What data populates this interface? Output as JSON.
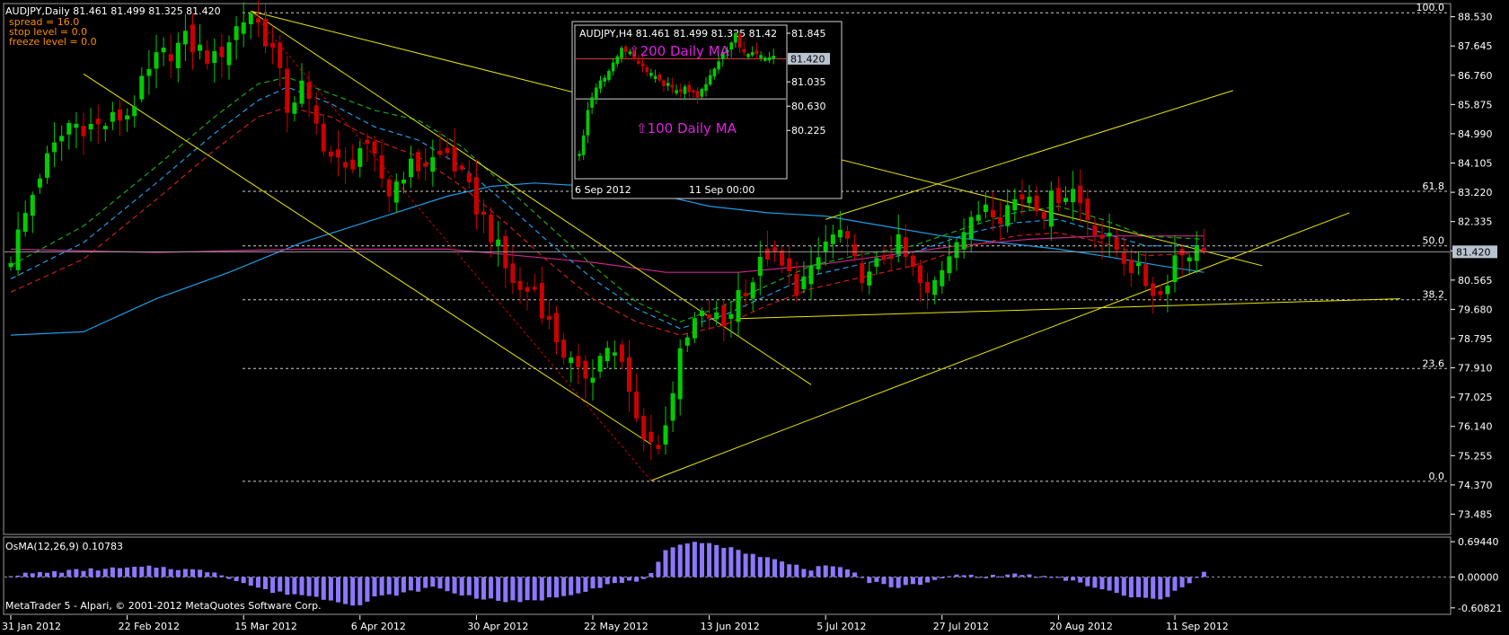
{
  "header": {
    "symbol_title": "AUDJPY,Daily  81.461 81.499 81.325 81.420",
    "spread": "spread = 16.0",
    "stop_level": "stop level = 0.0",
    "freeze_level": "freeze level = 0.0"
  },
  "footer": {
    "copyright": "MetaTrader 5 - Alpari, © 2001-2012 MetaQuotes Software Corp."
  },
  "colors": {
    "bull": "#00cc00",
    "bear": "#cc0000",
    "trendline": "#e6e600",
    "ma_blue": "#1e9be6",
    "ma_magenta": "#c8288c",
    "ma_green": "#1aa81a",
    "ma_red": "#c81e1e",
    "osma": "#8c78ff",
    "axis": "#ffffff"
  },
  "chart_data": [
    {
      "type": "candlestick",
      "symbol": "AUDJPY",
      "timeframe": "Daily",
      "current_price": 81.42,
      "current_price_label": "81.420",
      "ylim": [
        72.9,
        88.9
      ],
      "y_ticks": [
        "88.530",
        "87.645",
        "86.760",
        "85.875",
        "84.990",
        "84.105",
        "83.220",
        "82.335",
        "81.450",
        "80.565",
        "79.680",
        "78.795",
        "77.910",
        "77.025",
        "76.140",
        "75.255",
        "74.370",
        "73.485"
      ],
      "x_ticks": [
        {
          "label": "31 Jan 2012",
          "i": 0
        },
        {
          "label": "22 Feb 2012",
          "i": 16
        },
        {
          "label": "15 Mar 2012",
          "i": 32
        },
        {
          "label": "6 Apr 2012",
          "i": 48
        },
        {
          "label": "30 Apr 2012",
          "i": 64
        },
        {
          "label": "22 May 2012",
          "i": 80
        },
        {
          "label": "13 Jun 2012",
          "i": 96
        },
        {
          "label": "5 Jul 2012",
          "i": 112
        },
        {
          "label": "27 Jul 2012",
          "i": 128
        },
        {
          "label": "20 Aug 2012",
          "i": 144
        },
        {
          "label": "11 Sep 2012",
          "i": 160
        }
      ],
      "fibonacci": [
        {
          "label": "100.0",
          "price": 88.65
        },
        {
          "label": "61.8",
          "price": 83.25
        },
        {
          "label": "50.0",
          "price": 81.6
        },
        {
          "label": "38.2",
          "price": 79.97
        },
        {
          "label": "23.6",
          "price": 77.89
        },
        {
          "label": "0.0",
          "price": 74.48
        }
      ],
      "close_path": [
        [
          0,
          81.3
        ],
        [
          4,
          83.8
        ],
        [
          8,
          85.3
        ],
        [
          12,
          85.2
        ],
        [
          16,
          85.6
        ],
        [
          20,
          87.2
        ],
        [
          24,
          87.8
        ],
        [
          28,
          87.2
        ],
        [
          31,
          88.2
        ],
        [
          33,
          88.7
        ],
        [
          36,
          87.5
        ],
        [
          38,
          85.8
        ],
        [
          40,
          86.4
        ],
        [
          42,
          85.2
        ],
        [
          44,
          84.3
        ],
        [
          46,
          83.8
        ],
        [
          48,
          84.6
        ],
        [
          50,
          84.1
        ],
        [
          52,
          83.2
        ],
        [
          54,
          83.9
        ],
        [
          56,
          84.0
        ],
        [
          58,
          84.2
        ],
        [
          60,
          84.4
        ],
        [
          62,
          83.6
        ],
        [
          64,
          82.8
        ],
        [
          66,
          82.0
        ],
        [
          68,
          80.9
        ],
        [
          70,
          80.2
        ],
        [
          72,
          80.3
        ],
        [
          74,
          79.2
        ],
        [
          76,
          78.4
        ],
        [
          78,
          77.6
        ],
        [
          80,
          77.9
        ],
        [
          82,
          78.6
        ],
        [
          84,
          77.9
        ],
        [
          86,
          76.3
        ],
        [
          87,
          76.0
        ],
        [
          88,
          75.7
        ],
        [
          89,
          75.4
        ],
        [
          90,
          76.4
        ],
        [
          92,
          78.2
        ],
        [
          94,
          79.3
        ],
        [
          96,
          79.5
        ],
        [
          98,
          79.2
        ],
        [
          100,
          80.2
        ],
        [
          102,
          80.6
        ],
        [
          104,
          81.4
        ],
        [
          106,
          80.9
        ],
        [
          108,
          80.4
        ],
        [
          110,
          80.7
        ],
        [
          112,
          81.7
        ],
        [
          114,
          82.0
        ],
        [
          116,
          81.0
        ],
        [
          118,
          80.6
        ],
        [
          120,
          81.3
        ],
        [
          122,
          81.6
        ],
        [
          124,
          80.8
        ],
        [
          126,
          80.0
        ],
        [
          128,
          81.0
        ],
        [
          130,
          82.0
        ],
        [
          132,
          82.2
        ],
        [
          134,
          83.0
        ],
        [
          136,
          82.6
        ],
        [
          138,
          83.0
        ],
        [
          140,
          83.2
        ],
        [
          142,
          82.7
        ],
        [
          144,
          83.2
        ],
        [
          146,
          83.3
        ],
        [
          148,
          82.5
        ],
        [
          150,
          81.9
        ],
        [
          152,
          81.5
        ],
        [
          154,
          81.0
        ],
        [
          156,
          80.5
        ],
        [
          157,
          80.3
        ],
        [
          158,
          80.1
        ],
        [
          160,
          81.3
        ],
        [
          162,
          81.5
        ],
        [
          163,
          81.4
        ],
        [
          164,
          81.42
        ]
      ],
      "moving_averages": [
        {
          "color": "#1e9be6",
          "dash": "",
          "path": [
            [
              0,
              78.9
            ],
            [
              10,
              79.0
            ],
            [
              20,
              80.0
            ],
            [
              30,
              80.8
            ],
            [
              40,
              81.7
            ],
            [
              50,
              82.4
            ],
            [
              60,
              83.1
            ],
            [
              66,
              83.4
            ],
            [
              72,
              83.5
            ],
            [
              80,
              83.4
            ],
            [
              88,
              83.2
            ],
            [
              96,
              82.8
            ],
            [
              104,
              82.6
            ],
            [
              112,
              82.5
            ],
            [
              120,
              82.2
            ],
            [
              128,
              81.9
            ],
            [
              136,
              81.7
            ],
            [
              144,
              81.5
            ],
            [
              150,
              81.3
            ],
            [
              158,
              81.0
            ],
            [
              164,
              80.8
            ]
          ]
        },
        {
          "color": "#c8288c",
          "dash": "",
          "path": [
            [
              0,
              81.5
            ],
            [
              20,
              81.4
            ],
            [
              40,
              81.5
            ],
            [
              60,
              81.5
            ],
            [
              80,
              81.1
            ],
            [
              90,
              80.8
            ],
            [
              100,
              80.8
            ],
            [
              110,
              81.0
            ],
            [
              120,
              81.3
            ],
            [
              130,
              81.6
            ],
            [
              140,
              81.8
            ],
            [
              150,
              81.9
            ],
            [
              164,
              81.9
            ]
          ]
        },
        {
          "color": "#1aa81a",
          "dash": "6,4",
          "path": [
            [
              0,
              81.0
            ],
            [
              10,
              82.2
            ],
            [
              20,
              84.0
            ],
            [
              28,
              85.5
            ],
            [
              34,
              86.5
            ],
            [
              38,
              86.7
            ],
            [
              44,
              86.2
            ],
            [
              50,
              85.7
            ],
            [
              56,
              85.4
            ],
            [
              62,
              84.6
            ],
            [
              68,
              83.4
            ],
            [
              74,
              82.2
            ],
            [
              80,
              81.0
            ],
            [
              86,
              79.9
            ],
            [
              92,
              79.3
            ],
            [
              98,
              79.8
            ],
            [
              104,
              80.4
            ],
            [
              110,
              81.0
            ],
            [
              116,
              81.3
            ],
            [
              124,
              81.6
            ],
            [
              132,
              82.2
            ],
            [
              138,
              82.6
            ],
            [
              144,
              82.8
            ],
            [
              150,
              82.4
            ],
            [
              156,
              81.9
            ],
            [
              164,
              81.8
            ]
          ]
        },
        {
          "color": "#1e9be6",
          "dash": "6,4",
          "path": [
            [
              0,
              80.6
            ],
            [
              10,
              81.7
            ],
            [
              20,
              83.5
            ],
            [
              28,
              85.0
            ],
            [
              34,
              86.0
            ],
            [
              38,
              86.4
            ],
            [
              44,
              85.9
            ],
            [
              50,
              85.2
            ],
            [
              56,
              84.8
            ],
            [
              62,
              84.0
            ],
            [
              68,
              82.9
            ],
            [
              74,
              81.7
            ],
            [
              80,
              80.6
            ],
            [
              86,
              79.7
            ],
            [
              92,
              79.1
            ],
            [
              98,
              79.5
            ],
            [
              104,
              80.1
            ],
            [
              110,
              80.7
            ],
            [
              116,
              81.0
            ],
            [
              124,
              81.4
            ],
            [
              132,
              82.0
            ],
            [
              138,
              82.3
            ],
            [
              144,
              82.4
            ],
            [
              150,
              82.0
            ],
            [
              156,
              81.6
            ],
            [
              164,
              81.6
            ]
          ]
        },
        {
          "color": "#c81e1e",
          "dash": "6,4",
          "path": [
            [
              0,
              80.2
            ],
            [
              10,
              81.2
            ],
            [
              20,
              83.0
            ],
            [
              28,
              84.5
            ],
            [
              34,
              85.5
            ],
            [
              38,
              85.8
            ],
            [
              44,
              85.5
            ],
            [
              50,
              84.8
            ],
            [
              56,
              84.3
            ],
            [
              62,
              83.4
            ],
            [
              68,
              82.3
            ],
            [
              74,
              81.1
            ],
            [
              80,
              80.0
            ],
            [
              86,
              79.3
            ],
            [
              92,
              78.9
            ],
            [
              98,
              79.2
            ],
            [
              104,
              79.8
            ],
            [
              110,
              80.3
            ],
            [
              116,
              80.6
            ],
            [
              124,
              81.0
            ],
            [
              132,
              81.6
            ],
            [
              138,
              81.9
            ],
            [
              144,
              82.0
            ],
            [
              150,
              81.7
            ],
            [
              156,
              81.3
            ],
            [
              164,
              81.4
            ]
          ]
        }
      ],
      "trendlines": [
        {
          "from": [
            10,
            86.8
          ],
          "to": [
            88,
            75.6
          ],
          "dash": ""
        },
        {
          "from": [
            33,
            88.7
          ],
          "to": [
            110,
            77.4
          ],
          "dash": ""
        },
        {
          "from": [
            33,
            88.7
          ],
          "to": [
            88,
            74.5
          ],
          "dash": "3,3"
        },
        {
          "from": [
            33,
            88.7
          ],
          "to": [
            172,
            81.0
          ],
          "dash": ""
        },
        {
          "from": [
            88,
            74.5
          ],
          "to": [
            184,
            82.6
          ],
          "dash": ""
        },
        {
          "from": [
            112,
            82.4
          ],
          "to": [
            168,
            86.3
          ],
          "dash": ""
        },
        {
          "from": [
            100,
            79.4
          ],
          "to": [
            191,
            80.0
          ],
          "dash": ""
        }
      ]
    },
    {
      "type": "bar",
      "indicator": "OsMA(12,26,9) 0.10783",
      "ylim": [
        -0.7,
        0.75
      ],
      "y_ticks": [
        {
          "label": "0.69440",
          "value": 0.6944
        },
        {
          "label": "0.00000",
          "value": 0.0
        },
        {
          "label": "-0.60821",
          "value": -0.60821
        }
      ],
      "envelope": [
        [
          0,
          0.04
        ],
        [
          10,
          0.14
        ],
        [
          20,
          0.2
        ],
        [
          28,
          0.1
        ],
        [
          32,
          -0.12
        ],
        [
          36,
          -0.3
        ],
        [
          40,
          -0.35
        ],
        [
          44,
          -0.45
        ],
        [
          48,
          -0.56
        ],
        [
          50,
          -0.4
        ],
        [
          54,
          -0.32
        ],
        [
          58,
          -0.2
        ],
        [
          62,
          -0.35
        ],
        [
          66,
          -0.45
        ],
        [
          70,
          -0.5
        ],
        [
          74,
          -0.42
        ],
        [
          78,
          -0.3
        ],
        [
          82,
          -0.15
        ],
        [
          86,
          -0.08
        ],
        [
          88,
          0.05
        ],
        [
          90,
          0.5
        ],
        [
          94,
          0.72
        ],
        [
          98,
          0.6
        ],
        [
          102,
          0.45
        ],
        [
          106,
          0.3
        ],
        [
          110,
          0.15
        ],
        [
          112,
          0.25
        ],
        [
          116,
          0.08
        ],
        [
          118,
          -0.1
        ],
        [
          122,
          -0.2
        ],
        [
          126,
          -0.12
        ],
        [
          130,
          0.05
        ],
        [
          134,
          0.0
        ],
        [
          138,
          0.06
        ],
        [
          142,
          0.0
        ],
        [
          146,
          -0.08
        ],
        [
          150,
          -0.25
        ],
        [
          154,
          -0.4
        ],
        [
          158,
          -0.45
        ],
        [
          160,
          -0.3
        ],
        [
          162,
          -0.1
        ],
        [
          164,
          0.12
        ]
      ]
    }
  ],
  "inset": {
    "title": "AUDJPY,H4  81.461 81.499 81.325 81.42",
    "label_200": "⇧200 Daily MA",
    "label_100": "⇧100 Daily MA",
    "price_label": "81.420",
    "y_ticks": [
      "81.845",
      "81.035",
      "80.630",
      "80.225"
    ],
    "x_ticks": [
      "6 Sep 2012",
      "11 Sep 00:00"
    ],
    "ylim": [
      79.45,
      81.95
    ],
    "ma200_price": 81.42,
    "ma100_price": 80.75,
    "close_path": [
      [
        0,
        79.8
      ],
      [
        2,
        80.6
      ],
      [
        4,
        80.9
      ],
      [
        6,
        81.1
      ],
      [
        8,
        81.3
      ],
      [
        10,
        81.6
      ],
      [
        12,
        81.5
      ],
      [
        14,
        81.3
      ],
      [
        16,
        81.2
      ],
      [
        18,
        81.1
      ],
      [
        20,
        81.0
      ],
      [
        22,
        81.0
      ],
      [
        24,
        80.9
      ],
      [
        26,
        80.9
      ],
      [
        28,
        80.8
      ],
      [
        30,
        81.0
      ],
      [
        32,
        81.2
      ],
      [
        34,
        81.5
      ],
      [
        36,
        81.7
      ],
      [
        37,
        81.8
      ],
      [
        38,
        81.6
      ],
      [
        40,
        81.5
      ],
      [
        42,
        81.45
      ],
      [
        44,
        81.4
      ],
      [
        46,
        81.42
      ]
    ]
  }
}
